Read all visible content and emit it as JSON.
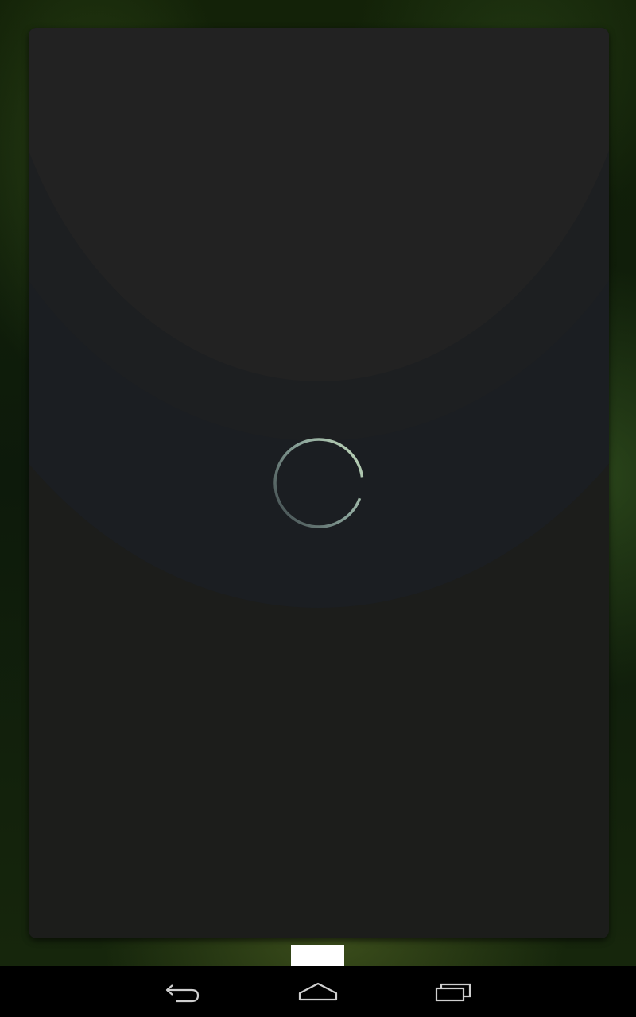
{
  "app": {
    "state": "loading"
  },
  "spinner": {
    "icon": "progress-spinner"
  },
  "page_indicator": {
    "icon": "page-indicator"
  },
  "navbar": {
    "back": {
      "icon": "back-icon"
    },
    "home": {
      "icon": "home-icon"
    },
    "recents": {
      "icon": "recent-apps-icon"
    }
  },
  "colors": {
    "card_background": "#1c1d1b",
    "spinner_accent": "#b7d0b0",
    "navbar_background": "#000000",
    "nav_icon": "#cfcfcf"
  }
}
